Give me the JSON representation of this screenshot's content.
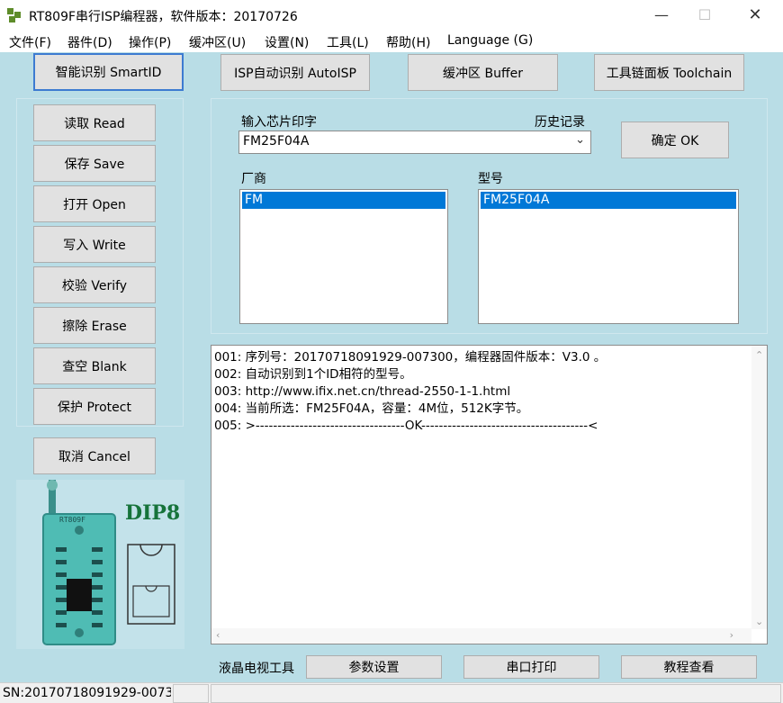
{
  "window": {
    "title": "RT809F串行ISP编程器，软件版本：20170726",
    "minimize_icon": "minimize-icon",
    "maximize_icon": "maximize-icon",
    "close_icon": "close-icon"
  },
  "menu": [
    "文件(F)",
    "器件(D)",
    "操作(P)",
    "缓冲区(U)",
    "设置(N)",
    "工具(L)",
    "帮助(H)",
    "Language (G)"
  ],
  "top_buttons": {
    "smartid": "智能识别 SmartID",
    "autoisp": "ISP自动识别 AutoISP",
    "buffer": "缓冲区 Buffer",
    "toolchain": "工具链面板 Toolchain"
  },
  "side_buttons": {
    "read": "读取 Read",
    "save": "保存 Save",
    "open": "打开 Open",
    "write": "写入 Write",
    "verify": "校验 Verify",
    "erase": "擦除 Erase",
    "blank": "查空 Blank",
    "protect": "保护 Protect",
    "cancel": "取消 Cancel"
  },
  "chip_input": {
    "label": "输入芯片印字",
    "history_label": "历史记录",
    "value": "FM25F04A",
    "ok_button": "确定 OK"
  },
  "manufacturer": {
    "label": "厂商",
    "selected": "FM"
  },
  "model": {
    "label": "型号",
    "selected": "FM25F04A"
  },
  "log": [
    "001: 序列号：20170718091929-007300，编程器固件版本：V3.0 。",
    "002: 自动识别到1个ID相符的型号。",
    "003: http://www.ifix.net.cn/thread-2550-1-1.html",
    "004: 当前所选：FM25F04A，容量：4M位，512K字节。",
    "005: >----------------------------------OK--------------------------------------<"
  ],
  "chip_image": {
    "socket_label": "DIP8",
    "brand_text": "RT809F"
  },
  "bottom_bar": {
    "lcd_tool_label": "液晶电视工具",
    "param_button": "参数设置",
    "serial_print_button": "串口打印",
    "tutorial_button": "教程查看"
  },
  "status": {
    "serial": "SN:20170718091929-0073"
  }
}
